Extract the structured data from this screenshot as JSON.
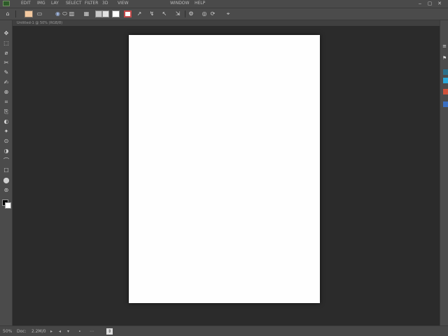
{
  "menubar": {
    "logo": "app-logo",
    "items": [
      "EDIT",
      "IMG",
      "LAY",
      "SELECT",
      "FILTER",
      "3D",
      "VIEW",
      "WINDOW",
      "HELP"
    ],
    "window_controls": {
      "minimize": "‒",
      "restore": "▢",
      "close": "✕"
    }
  },
  "optionsbar": {
    "tool_preset": "⌂",
    "buttons": [
      "▭",
      "◉",
      "⬭",
      "▥",
      "▦",
      "▤",
      "▣",
      "↗",
      "↯",
      "↖",
      "⇲",
      "⚙",
      "◎",
      "⟳",
      "⌖"
    ]
  },
  "document_tab": {
    "label": "Untitled-1 @ 50% (RGB/8)"
  },
  "tools": {
    "icons": [
      "✥",
      "⬚",
      "⌀",
      "✂",
      "✎",
      "✍",
      "⊕",
      "⌗",
      "⎘",
      "◐",
      "✦",
      "⊙",
      "◑",
      "⌒",
      "☐",
      "⬤",
      "⊚"
    ],
    "foreground_color": "#000000",
    "background_color": "#ffffff"
  },
  "rightpanel": {
    "icons": [
      "≡",
      "⚑",
      "▣",
      "⬚"
    ],
    "swatches": [
      "#29a8d9",
      "#d0523a",
      "#3a6fc2"
    ]
  },
  "statusbar": {
    "items": [
      "50%",
      "Doc:",
      "2.2M/0",
      "▸",
      "◂",
      "▾",
      "∙",
      "⋯",
      "⇕"
    ]
  },
  "colors": {
    "canvas_bg": "#2b2b2b",
    "document": "#fefefe",
    "panel": "#4b4b4b"
  }
}
